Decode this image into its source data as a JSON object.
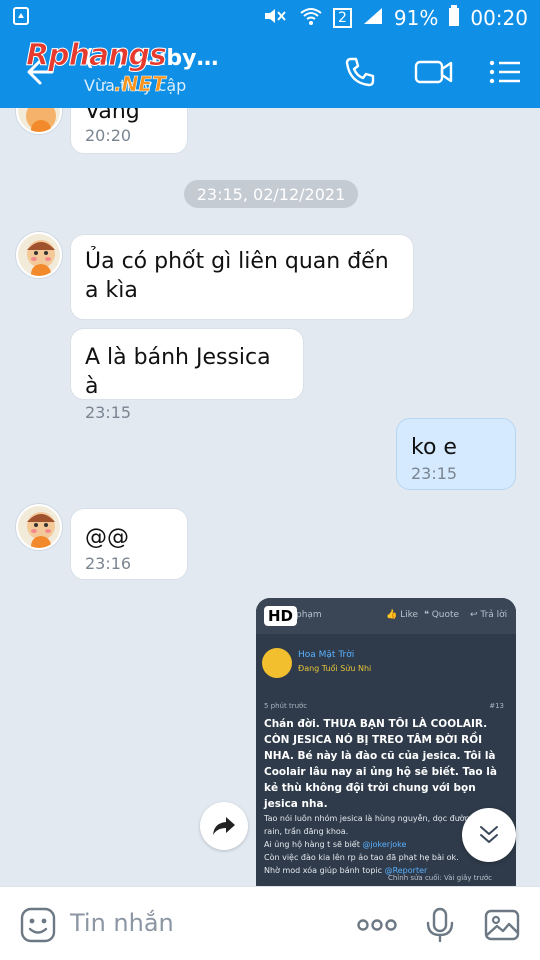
{
  "status_bar": {
    "battery_percent": "91%",
    "time": "00:20",
    "sim_badge": "2"
  },
  "header": {
    "title": "(…) Ruby…",
    "subtitle": "Vừa truy cập",
    "watermark": "Rphangs .NET"
  },
  "messages": [
    {
      "from": "them",
      "text": "Vâng",
      "time": "20:20"
    },
    {
      "type": "date",
      "text": "23:15, 02/12/2021"
    },
    {
      "from": "them",
      "text": "Ủa có phốt gì liên quan đến a kìa",
      "time": ""
    },
    {
      "from": "them",
      "text": "A là bánh Jessica à",
      "time": "23:15"
    },
    {
      "from": "me",
      "text": "ko e",
      "time": "23:15"
    },
    {
      "from": "them",
      "text": "@@",
      "time": "23:16"
    }
  ],
  "photo": {
    "badge": "HD",
    "top_text": "phạm",
    "like": "Like",
    "quote": "Quote",
    "reply": "Trả lời",
    "author": "Hoa Mặt Trời",
    "rank": "Đang Tuổi Sửu Nhi",
    "meta": "5 phút trước",
    "post_num": "#13",
    "body_main": "Chán đời. THƯA BẠN TÔI LÀ COOLAIR. CÒN JESICA NÓ BỊ TREO TÂM ĐỜI RỒI NHA. Bé này là đào cũ của jesica. Tôi là Coolair lâu nay ai ủng hộ sẽ biết. Tao là kẻ thù không đội trời chung với bọn jesica nha.",
    "body_small_1": "Tao nói luôn nhóm jesica là hùng nguyễn, dọc đường gió bụi, rain, trần đăng khoa.",
    "body_small_2a": "Ai ủng hộ hàng t sẽ biết ",
    "body_small_2_link": "@jokerjoke",
    "body_small_3": "Còn việc đào kia lên rp ảo tao đã phạt hẹ bài ok.",
    "body_small_4a": "Nhờ mod xóa giúp bánh topic ",
    "body_small_4_link": "@Reporter",
    "footer": "Chỉnh sửa cuối: Vài giây trước"
  },
  "composer": {
    "placeholder": "Tin nhắn"
  }
}
